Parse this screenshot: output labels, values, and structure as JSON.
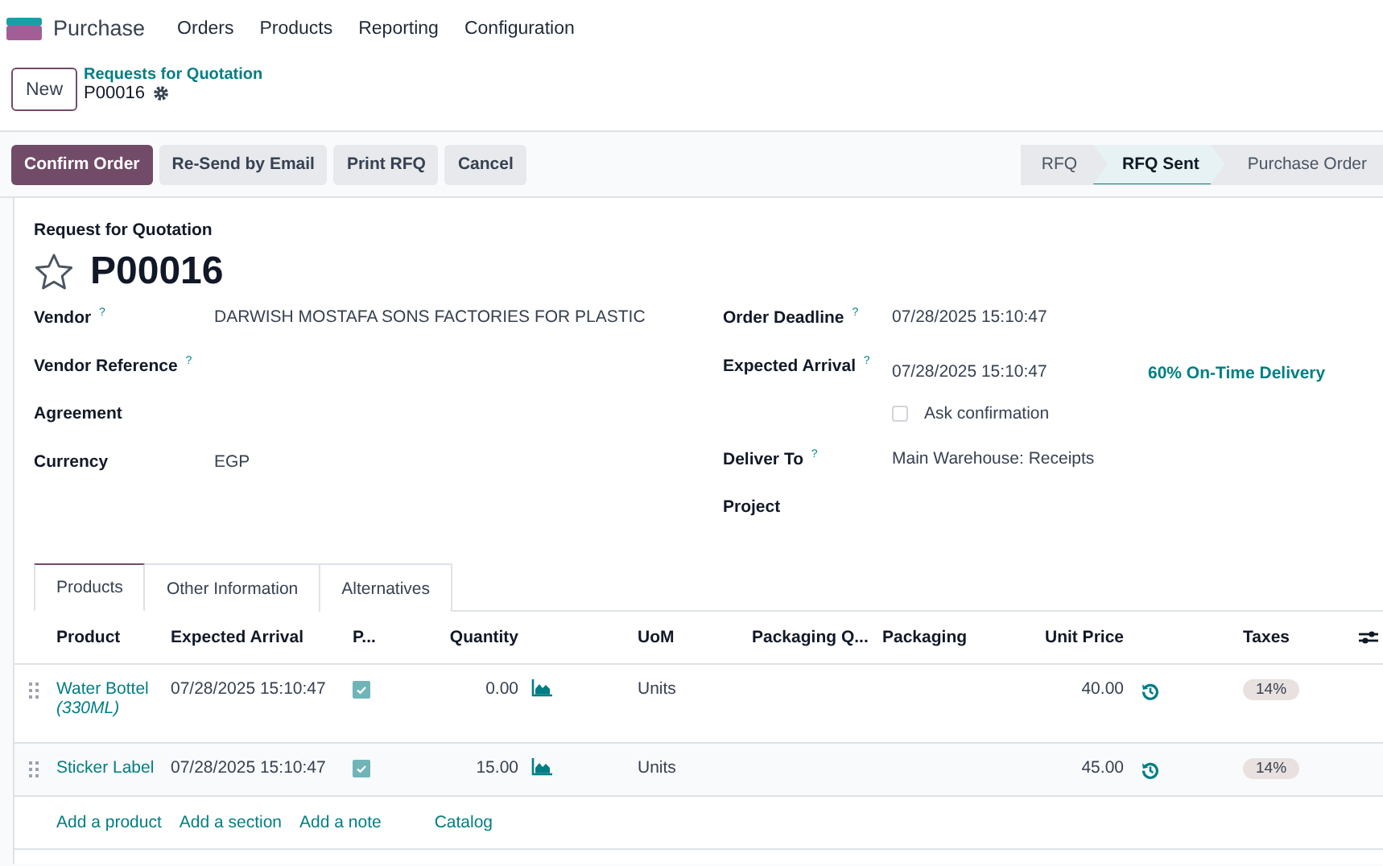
{
  "app": {
    "name": "Purchase"
  },
  "menu": [
    "Orders",
    "Products",
    "Reporting",
    "Configuration"
  ],
  "breadcrumb": {
    "new_button": "New",
    "parent": "Requests for Quotation",
    "current": "P00016"
  },
  "actions": [
    {
      "label": "Confirm Order",
      "primary": true
    },
    {
      "label": "Re-Send by Email",
      "primary": false
    },
    {
      "label": "Print RFQ",
      "primary": false
    },
    {
      "label": "Cancel",
      "primary": false
    }
  ],
  "stages": [
    {
      "label": "RFQ",
      "selected": false
    },
    {
      "label": "RFQ Sent",
      "selected": true
    },
    {
      "label": "Purchase Order",
      "selected": false
    }
  ],
  "form": {
    "subtitle": "Request for Quotation",
    "title": "P00016",
    "favorite": false,
    "left_fields": [
      {
        "label": "Vendor",
        "help": "?",
        "value": "DARWISH MOSTAFA SONS FACTORIES FOR PLASTIC"
      },
      {
        "label": "Vendor Reference",
        "help": "?"
      },
      {
        "label": "Agreement"
      },
      {
        "label": "Currency",
        "value": "EGP"
      }
    ],
    "right_fields": [
      {
        "kind": "field",
        "label": "Order Deadline",
        "help": "?",
        "value": "07/28/2025 15:10:47"
      },
      {
        "kind": "field",
        "label": "Expected Arrival",
        "help": "?",
        "value": "07/28/2025 15:10:47",
        "extra": "60% On-Time Delivery"
      },
      {
        "kind": "checkbox",
        "label": "Ask confirmation",
        "checked": false
      },
      {
        "kind": "field",
        "label": "Deliver To",
        "help": "?",
        "value": "Main Warehouse: Receipts"
      },
      {
        "kind": "field",
        "label": "Project"
      }
    ]
  },
  "tabs": [
    {
      "label": "Products",
      "selected": true
    },
    {
      "label": "Other Information",
      "selected": false
    },
    {
      "label": "Alternatives",
      "selected": false
    }
  ],
  "table": {
    "columns": [
      "Product",
      "Expected Arrival",
      "P...",
      "Quantity",
      "UoM",
      "Packaging Q...",
      "Packaging",
      "Unit Price",
      "Taxes"
    ],
    "rows": [
      {
        "product": "Water Bottel *(330ML)*",
        "expected_arrival": "07/28/2025 15:10:47",
        "checked": true,
        "quantity": "0.00",
        "uom": "Units",
        "unit_price": "40.00",
        "taxes": "14%"
      },
      {
        "product": "Sticker Label",
        "expected_arrival": "07/28/2025 15:10:47",
        "checked": true,
        "quantity": "15.00",
        "uom": "Units",
        "unit_price": "45.00",
        "taxes": "14%"
      }
    ],
    "add_links": [
      "Add a product",
      "Add a section",
      "Add a note",
      "Catalog"
    ]
  }
}
